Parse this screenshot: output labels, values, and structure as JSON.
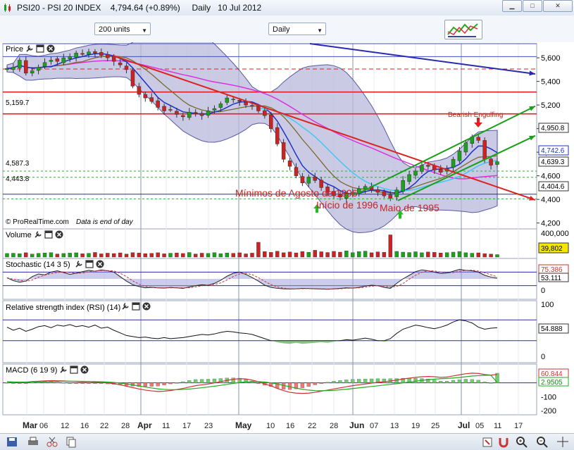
{
  "window": {
    "title": "PSI20 - PSI 20 INDEX",
    "last_value": "4,794.64 (+0.89%)",
    "period": "Daily",
    "date": "10 Jul 2012"
  },
  "toolbar": {
    "units_select": "200 units",
    "timeframe_select": "Daily"
  },
  "colors": {
    "bull": "#1aa31a",
    "bear": "#cc2222",
    "band_fill": "#b8b8dc",
    "ma_magenta": "#dd33dd",
    "ma_blue": "#1c32c4",
    "ma_olive": "#7a6a2a",
    "ma_cyan": "#44c8ee",
    "trend_red": "#dd2222",
    "trend_green": "#18a018",
    "trend_navy": "#2a2ab0"
  },
  "chart_data": [
    {
      "panel": "Price",
      "type": "candlestick",
      "title": "Price",
      "x_labels": [
        "Mar",
        "06",
        "12",
        "16",
        "22",
        "28",
        "Apr",
        "11",
        "17",
        "23",
        "May",
        "10",
        "16",
        "22",
        "28",
        "Jun",
        "07",
        "13",
        "19",
        "25",
        "Jul",
        "05",
        "11",
        "17"
      ],
      "y_ticks": [
        4200,
        4400,
        4600,
        4800,
        5000,
        5200,
        5400,
        5600
      ],
      "ylim": [
        4150,
        5720
      ],
      "closes": [
        5510,
        5520,
        5580,
        5470,
        5490,
        5520,
        5560,
        5580,
        5570,
        5600,
        5610,
        5640,
        5630,
        5650,
        5640,
        5620,
        5600,
        5570,
        5540,
        5500,
        5360,
        5290,
        5260,
        5230,
        5180,
        5150,
        5160,
        5120,
        5100,
        5140,
        5130,
        5110,
        5150,
        5170,
        5210,
        5260,
        5250,
        5230,
        5200,
        5190,
        5150,
        5110,
        5000,
        4870,
        4740,
        4680,
        4600,
        4540,
        4590,
        4560,
        4500,
        4460,
        4430,
        4420,
        4450,
        4460,
        4490,
        4510,
        4480,
        4460,
        4430,
        4410,
        4480,
        4560,
        4610,
        4640,
        4690,
        4680,
        4650,
        4630,
        4660,
        4740,
        4810,
        4880,
        4930,
        4900,
        4740,
        4690,
        4720
      ],
      "price_labels": [
        "5,159.7",
        "4,587.3",
        "4,443.8"
      ],
      "price_label_values": [
        5159.7,
        4587.3,
        4443.8
      ],
      "right_tags": [
        "4,950.8",
        "4,742.6",
        "4,639.3",
        "4,404.6"
      ],
      "right_tag_values": [
        4950.8,
        4742.6,
        4639.3,
        4404.6
      ],
      "annotations": [
        "Bearish Engulfing",
        "Mínimos de Agosto de 1996",
        "Início de 1996",
        "Maio de 1995"
      ],
      "horizontal_levels": [
        5720,
        5610,
        5505,
        5310,
        5125,
        4443.8
      ],
      "footnote_brand": "© ProRealTime.com",
      "footnote_note": "Data is end of day"
    },
    {
      "panel": "Volume",
      "type": "bar",
      "title": "Volume",
      "y_ticks": [
        "400,000"
      ],
      "ylim": [
        0,
        400000
      ],
      "right_tag": "39,802",
      "values": [
        58000,
        62000,
        55000,
        70000,
        48000,
        60000,
        66000,
        72000,
        50000,
        58000,
        64000,
        69000,
        54000,
        61000,
        75000,
        52000,
        63000,
        57000,
        68000,
        49000,
        72000,
        65000,
        56000,
        60000,
        70000,
        53000,
        62000,
        67000,
        58000,
        74000,
        50000,
        63000,
        59000,
        71000,
        55000,
        66000,
        61000,
        69000,
        52000,
        64000,
        240000,
        88000,
        76000,
        95000,
        70000,
        82000,
        68000,
        90000,
        78000,
        110000,
        86000,
        74000,
        92000,
        80000,
        100000,
        72000,
        88000,
        96000,
        70000,
        84000,
        78000,
        360000,
        92000,
        80000,
        74000,
        86000,
        70000,
        82000,
        76000,
        66000,
        72000,
        80000,
        90000,
        70000,
        62000,
        68000,
        56000,
        48000,
        39802
      ]
    },
    {
      "panel": "Stochastic",
      "type": "line",
      "title": "Stochastic (14 3 5)",
      "y_ticks": [
        "100",
        "0"
      ],
      "ylim": [
        0,
        100
      ],
      "right_tags": [
        "75.386",
        "53.111"
      ],
      "values": [
        55,
        42,
        35,
        40,
        60,
        72,
        68,
        80,
        86,
        78,
        70,
        75,
        82,
        88,
        84,
        90,
        86,
        80,
        60,
        40,
        24,
        16,
        10,
        12,
        10,
        9,
        12,
        10,
        8,
        14,
        20,
        24,
        22,
        30,
        44,
        62,
        75,
        80,
        70,
        56,
        40,
        22,
        12,
        8,
        6,
        5,
        6,
        8,
        7,
        6,
        5,
        4,
        6,
        8,
        10,
        9,
        12,
        18,
        22,
        20,
        12,
        8,
        30,
        50,
        66,
        82,
        90,
        86,
        80,
        74,
        76,
        84,
        92,
        88,
        86,
        80,
        66,
        58,
        53.111
      ]
    },
    {
      "panel": "RSI",
      "type": "line",
      "title": "Relative strength index (RSI) (14)",
      "y_ticks": [
        "100",
        "0"
      ],
      "ylim": [
        0,
        100
      ],
      "right_tag": "54.888",
      "values": [
        56,
        50,
        54,
        48,
        52,
        57,
        59,
        55,
        60,
        58,
        61,
        57,
        59,
        56,
        60,
        54,
        56,
        50,
        45,
        40,
        38,
        36,
        37,
        35,
        34,
        36,
        34,
        35,
        36,
        38,
        40,
        42,
        41,
        43,
        46,
        48,
        47,
        45,
        44,
        42,
        38,
        34,
        30,
        27,
        25,
        24,
        26,
        24,
        25,
        26,
        27,
        26,
        28,
        30,
        32,
        31,
        33,
        35,
        33,
        30,
        28,
        34,
        44,
        52,
        56,
        60,
        58,
        55,
        53,
        56,
        60,
        66,
        70,
        68,
        64,
        56,
        52,
        54,
        54.888
      ]
    },
    {
      "panel": "MACD",
      "type": "bar",
      "title": "MACD (6 19 9)",
      "y_ticks": [
        "0",
        "-100",
        "-200"
      ],
      "ylim": [
        -220,
        110
      ],
      "right_tags": [
        "60.844",
        "2.9505"
      ],
      "values": [
        8,
        6,
        3,
        5,
        10,
        12,
        14,
        16,
        15,
        14,
        12,
        10,
        8,
        9,
        6,
        4,
        0,
        -6,
        -14,
        -24,
        -34,
        -44,
        -52,
        -58,
        -62,
        -60,
        -55,
        -48,
        -40,
        -30,
        -20,
        -14,
        -8,
        0,
        8,
        18,
        26,
        30,
        28,
        20,
        8,
        -8,
        -22,
        -40,
        -56,
        -68,
        -74,
        -76,
        -74,
        -68,
        -60,
        -52,
        -44,
        -36,
        -28,
        -20,
        -14,
        -8,
        -2,
        4,
        8,
        14,
        20,
        28,
        34,
        40,
        44,
        46,
        44,
        40,
        42,
        50,
        58,
        66,
        70,
        68,
        60,
        56,
        60.844
      ],
      "signal": [
        6,
        6,
        6,
        6,
        7,
        8,
        9,
        10,
        11,
        12,
        12,
        12,
        11,
        10,
        9,
        8,
        6,
        3,
        -2,
        -8,
        -15,
        -22,
        -30,
        -37,
        -43,
        -47,
        -49,
        -49,
        -47,
        -44,
        -40,
        -35,
        -30,
        -24,
        -18,
        -11,
        -4,
        2,
        7,
        9,
        9,
        6,
        0,
        -8,
        -18,
        -28,
        -38,
        -46,
        -52,
        -56,
        -57,
        -56,
        -54,
        -50,
        -46,
        -41,
        -36,
        -31,
        -26,
        -21,
        -16,
        -11,
        -6,
        0,
        6,
        12,
        18,
        23,
        27,
        30,
        32,
        35,
        39,
        44,
        49,
        52,
        54,
        55,
        2.9505
      ]
    }
  ]
}
